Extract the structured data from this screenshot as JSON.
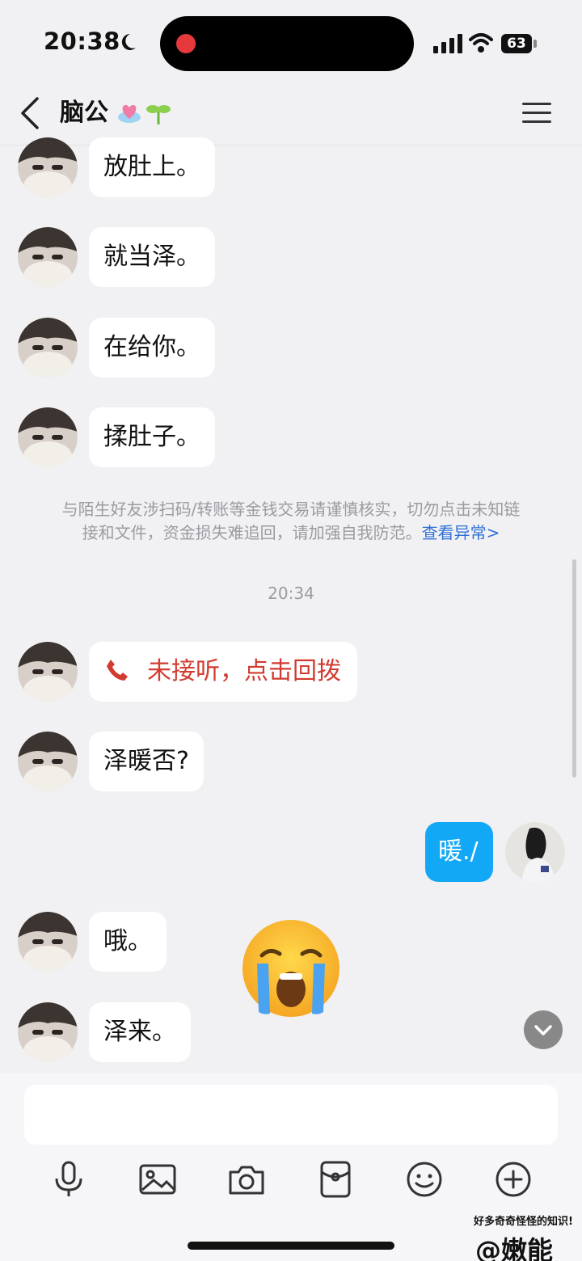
{
  "status_bar": {
    "time": "20:38",
    "battery": "63"
  },
  "header": {
    "title": "脑公"
  },
  "messages_top": [
    {
      "text": "放肚上。"
    },
    {
      "text": "就当泽。"
    },
    {
      "text": "在给你。"
    },
    {
      "text": "揉肚子。"
    }
  ],
  "notice": {
    "line1": "与陌生好友涉扫码/转账等金钱交易请谨慎核实，切勿点击未知链",
    "line2": "接和文件，资金损失难追回，请加强自我防范。",
    "link": "查看异常>"
  },
  "timestamp": "20:34",
  "messages_bottom": {
    "missed_call": "未接听，点击回拨",
    "msg1": "泽暖否?",
    "self_msg": "暖./",
    "msg2": "哦。",
    "msg3": "泽来。"
  },
  "input": {
    "placeholder": ""
  },
  "toolbar": [
    "microphone-icon",
    "image-icon",
    "camera-icon",
    "red-packet-icon",
    "emoji-icon",
    "plus-icon"
  ],
  "watermark": {
    "small": "好多奇奇怪怪的知识!",
    "handle": "@嫩能"
  },
  "colors": {
    "self_bubble": "#12a8f5",
    "missed_call": "#d23b30",
    "link": "#2f6fd6"
  }
}
